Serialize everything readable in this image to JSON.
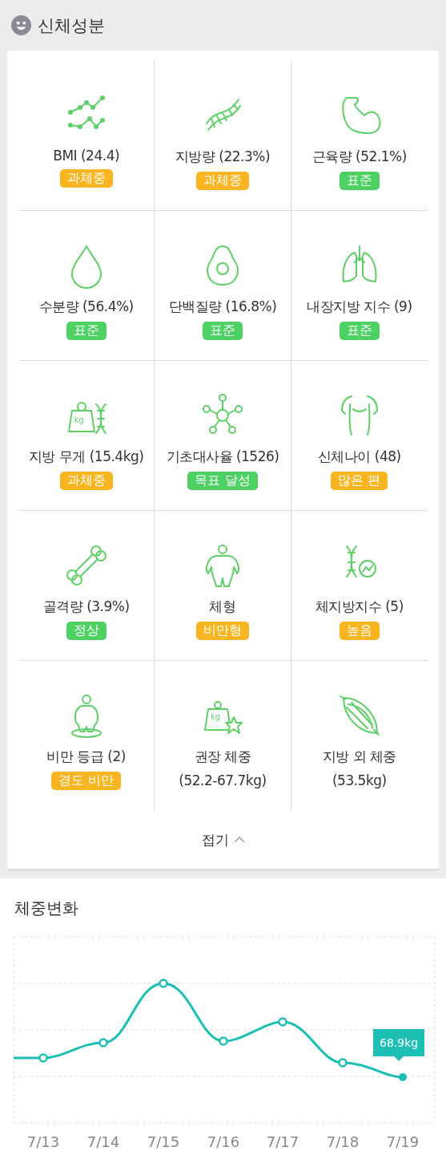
{
  "header": {
    "title": "신체성분"
  },
  "metrics": [
    {
      "label": "BMI (24.4)",
      "badge": {
        "text": "과체중",
        "color": "#f9b51f"
      }
    },
    {
      "label": "지방량 (22.3%)",
      "badge": {
        "text": "과체중",
        "color": "#f9b51f"
      }
    },
    {
      "label": "근육량 (52.1%)",
      "badge": {
        "text": "표준",
        "color": "#4dd163"
      }
    },
    {
      "label": "수분량 (56.4%)",
      "badge": {
        "text": "표준",
        "color": "#4dd163"
      }
    },
    {
      "label": "단백질량 (16.8%)",
      "badge": {
        "text": "표준",
        "color": "#4dd163"
      }
    },
    {
      "label": "내장지방 지수 (9)",
      "badge": {
        "text": "표준",
        "color": "#4dd163"
      }
    },
    {
      "label": "지방 무게 (15.4kg)",
      "badge": {
        "text": "과체중",
        "color": "#f9b51f"
      }
    },
    {
      "label": "기초대사율 (1526)",
      "badge": {
        "text": "목표 달성",
        "color": "#4dd163"
      }
    },
    {
      "label": "신체나이 (48)",
      "badge": {
        "text": "많은 편",
        "color": "#f9b51f"
      }
    },
    {
      "label": "골격량 (3.9%)",
      "badge": {
        "text": "정상",
        "color": "#4dd163"
      }
    },
    {
      "label": "체형",
      "badge": {
        "text": "비만형",
        "color": "#f9b51f"
      }
    },
    {
      "label": "체지방지수 (5)",
      "badge": {
        "text": "높음",
        "color": "#f9b51f"
      }
    },
    {
      "label": "비만 등급 (2)",
      "badge": {
        "text": "경도 비만",
        "color": "#f9b51f"
      }
    },
    {
      "label": "권장 체중",
      "detail": "(52.2-67.7kg)"
    },
    {
      "label": "지방 외 체중",
      "detail": "(53.5kg)"
    }
  ],
  "icon_labels": [
    "kg",
    "kg"
  ],
  "collapse": {
    "label": "접기"
  },
  "weight_section": {
    "title": "체중변화",
    "tooltip": "68.9kg",
    "x_labels": [
      "7/13",
      "7/14",
      "7/15",
      "7/16",
      "7/17",
      "7/18",
      "7/19"
    ]
  }
}
